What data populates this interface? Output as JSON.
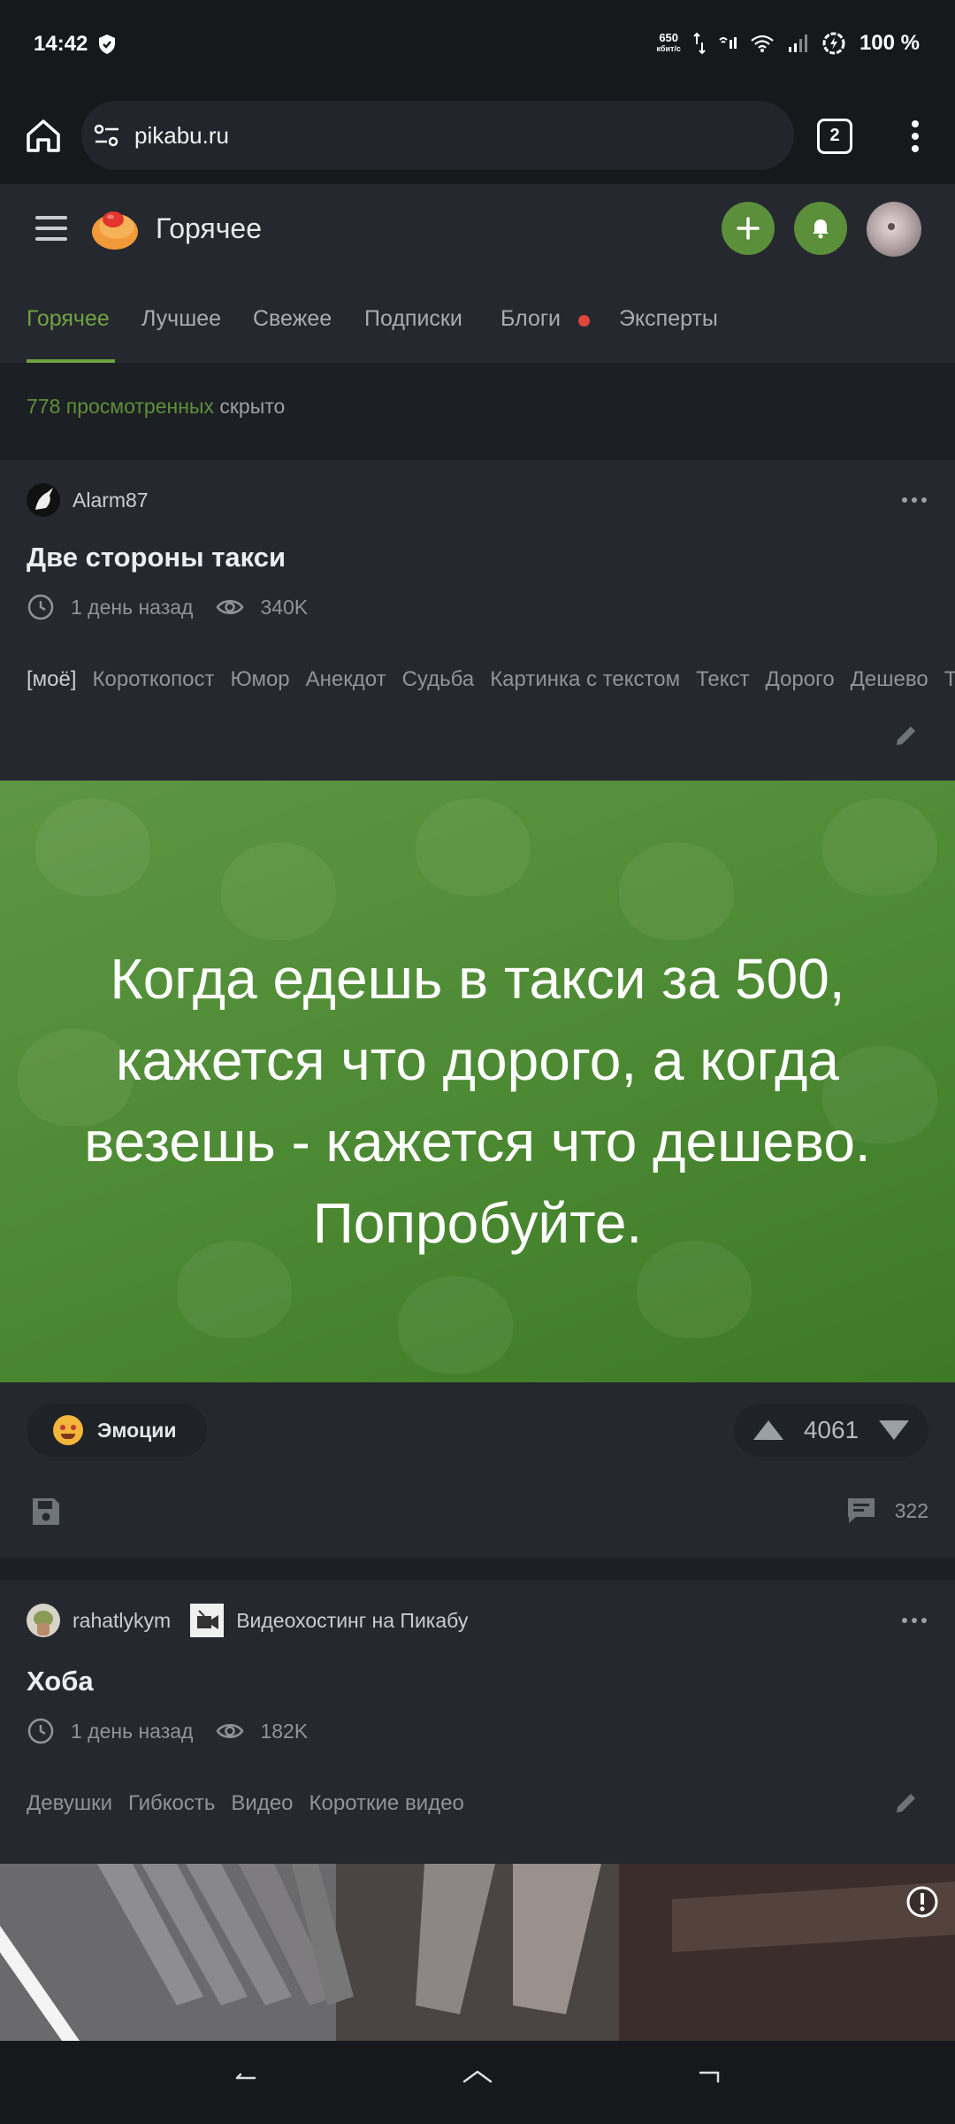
{
  "status": {
    "time": "14:42",
    "speed_value": "650",
    "speed_unit": "кбит/с",
    "battery": "100 %"
  },
  "browser": {
    "url": "pikabu.ru",
    "tab_count": "2"
  },
  "site": {
    "title": "Горячее"
  },
  "nav_tabs": [
    {
      "label": "Горячее",
      "active": true
    },
    {
      "label": "Лучшее"
    },
    {
      "label": "Свежее"
    },
    {
      "label": "Подписки"
    },
    {
      "label": "Блоги",
      "badge": true
    },
    {
      "label": "Эксперты"
    }
  ],
  "viewed": {
    "count_text": "778 просмотренных",
    "suffix": "скрыто"
  },
  "posts": [
    {
      "author": "Alarm87",
      "title": "Две стороны такси",
      "time": "1 день назад",
      "views": "340K",
      "tags": [
        "[моё]",
        "Короткопост",
        "Юмор",
        "Анекдот",
        "Судьба",
        "Картинка с текстом",
        "Текст",
        "Дорого",
        "Дешево",
        "Такси"
      ],
      "image_text": "Когда едешь в такси за 500, кажется что дорого, а когда везешь - кажется что дешево. Попробуйте.",
      "emotions_label": "Эмоции",
      "rating": "4061",
      "comments": "322"
    },
    {
      "author": "rahatlykym",
      "community": "Видеохостинг на Пикабу",
      "title": "Хоба",
      "time": "1 день назад",
      "views": "182K",
      "tags": [
        "Девушки",
        "Гибкость",
        "Видео",
        "Короткие видео"
      ]
    }
  ],
  "colors": {
    "accent": "#6fa33f",
    "button_green": "#5b8f3a",
    "background": "#1c1f24",
    "card": "#25282e"
  }
}
